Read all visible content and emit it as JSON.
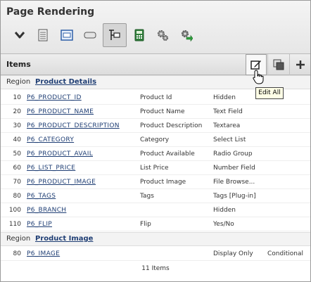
{
  "page": {
    "title": "Page Rendering"
  },
  "toolbar": {
    "buttons": [
      {
        "icon": "chevron-down-icon",
        "active": false
      },
      {
        "icon": "page-icon",
        "active": false
      },
      {
        "icon": "region-icon",
        "active": false
      },
      {
        "icon": "button-icon",
        "active": false
      },
      {
        "icon": "item-tree-icon",
        "active": true
      },
      {
        "icon": "computation-icon",
        "active": false
      },
      {
        "icon": "process-gear-icon",
        "active": false
      },
      {
        "icon": "branch-gear-icon",
        "active": false
      }
    ]
  },
  "items": {
    "title": "Items",
    "tooltip": "Edit All",
    "region_label": "Region",
    "regions": [
      {
        "name": "Product Details",
        "rows": [
          {
            "seq": "10",
            "name": "P6_PRODUCT_ID",
            "label": "Product Id",
            "type": "Hidden",
            "condition": ""
          },
          {
            "seq": "20",
            "name": "P6_PRODUCT_NAME",
            "label": "Product Name",
            "type": "Text Field",
            "condition": ""
          },
          {
            "seq": "30",
            "name": "P6_PRODUCT_DESCRIPTION",
            "label": "Product Description",
            "type": "Textarea",
            "condition": ""
          },
          {
            "seq": "40",
            "name": "P6_CATEGORY",
            "label": "Category",
            "type": "Select List",
            "condition": ""
          },
          {
            "seq": "50",
            "name": "P6_PRODUCT_AVAIL",
            "label": "Product Available",
            "type": "Radio Group",
            "condition": ""
          },
          {
            "seq": "60",
            "name": "P6_LIST_PRICE",
            "label": "List Price",
            "type": "Number Field",
            "condition": ""
          },
          {
            "seq": "70",
            "name": "P6_PRODUCT_IMAGE",
            "label": "Product Image",
            "type": "File Browse...",
            "condition": ""
          },
          {
            "seq": "80",
            "name": "P6_TAGS",
            "label": "Tags",
            "type": "Tags [Plug-in]",
            "condition": ""
          },
          {
            "seq": "100",
            "name": "P6_BRANCH",
            "label": "",
            "type": "Hidden",
            "condition": ""
          },
          {
            "seq": "110",
            "name": "P6_FLIP",
            "label": "Flip",
            "type": "Yes/No",
            "condition": ""
          }
        ]
      },
      {
        "name": "Product Image",
        "rows": [
          {
            "seq": "80",
            "name": "P6_IMAGE",
            "label": "",
            "type": "Display Only",
            "condition": "Conditional"
          }
        ]
      }
    ],
    "count_text": "11 Items"
  }
}
